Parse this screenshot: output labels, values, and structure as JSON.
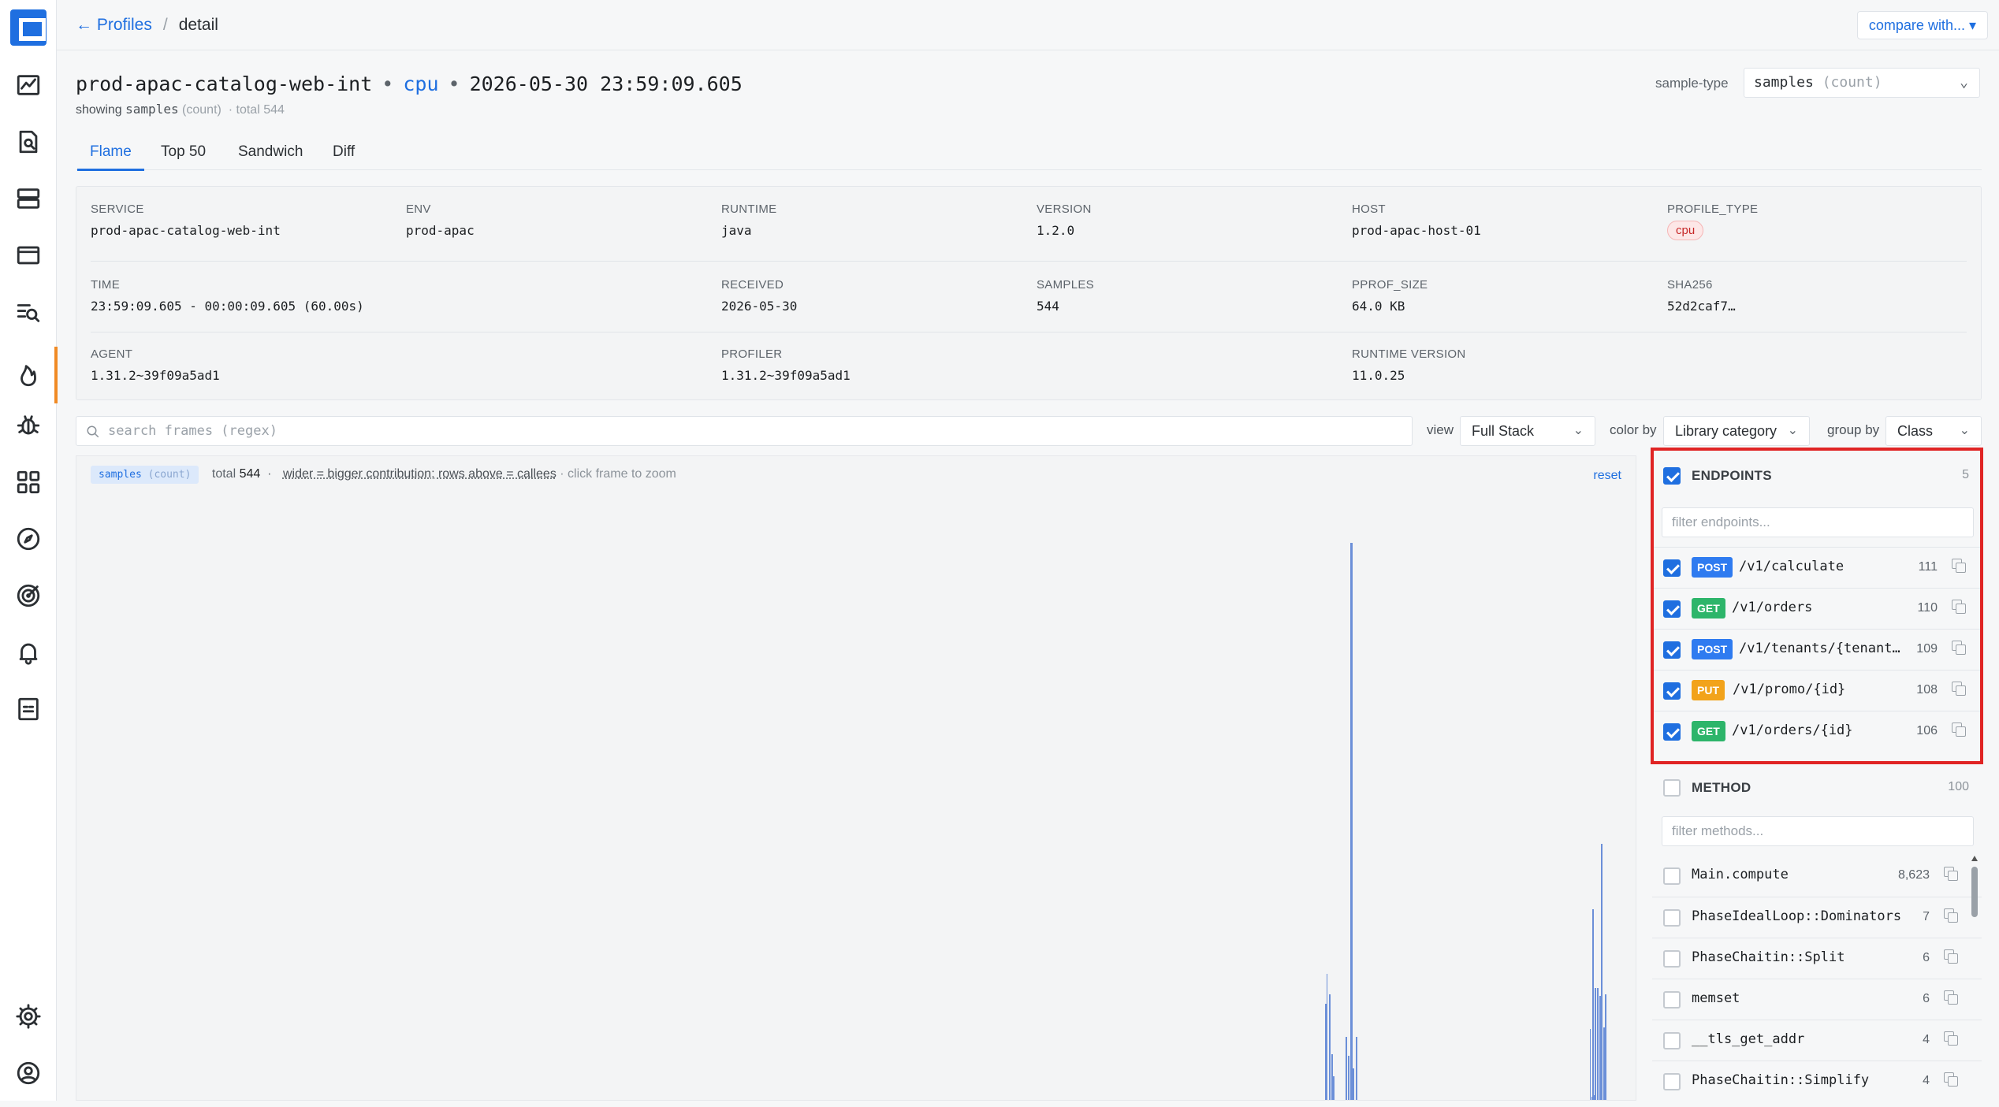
{
  "nav": {
    "items": [
      "dashboard-icon",
      "search-doc-icon",
      "servers-icon",
      "card-icon",
      "search-list-icon",
      "flame-icon",
      "bug-icon",
      "grid-icon",
      "compass-icon",
      "target-icon",
      "bell-icon",
      "report-icon",
      "gear-icon",
      "account-icon"
    ],
    "active": "flame-icon"
  },
  "header": {
    "back_label": "← Profiles",
    "separator": "/",
    "current": "detail",
    "compare_label": "compare with... ▾"
  },
  "profile": {
    "service": "prod-apac-catalog-web-int",
    "dot": "•",
    "type": "cpu",
    "timestamp": "2026-05-30 23:59:09.605",
    "showing_label": "showing",
    "sample_name": "samples",
    "sample_unit": "(count)",
    "total_label": "· total 544"
  },
  "sample_type": {
    "label": "sample-type",
    "value": "samples",
    "unit": "(count)"
  },
  "tabs": [
    "Flame",
    "Top 50",
    "Sandwich",
    "Diff"
  ],
  "active_tab": "Flame",
  "meta": {
    "service_label": "SERVICE",
    "service": "prod-apac-catalog-web-int",
    "env_label": "ENV",
    "env": "prod-apac",
    "runtime_label": "RUNTIME",
    "runtime": "java",
    "version_label": "VERSION",
    "version": "1.2.0",
    "host_label": "HOST",
    "host": "prod-apac-host-01",
    "profile_type_label": "PROFILE_TYPE",
    "profile_type": "cpu",
    "time_label": "TIME",
    "time": "23:59:09.605 - 00:00:09.605 (60.00s)",
    "received_label": "RECEIVED",
    "received": "2026-05-30",
    "samples_label": "SAMPLES",
    "samples": "544",
    "pprof_size_label": "PPROF_SIZE",
    "pprof_size": "64.0 KB",
    "sha_label": "SHA256",
    "sha": "52d2caf7…",
    "agent_label": "AGENT",
    "agent": "1.31.2~39f09a5ad1",
    "profiler_label": "PROFILER",
    "profiler": "1.31.2~39f09a5ad1",
    "runtime_version_label": "RUNTIME VERSION",
    "runtime_version": "11.0.25"
  },
  "controls": {
    "search_placeholder": "search frames (regex)",
    "view_label": "view",
    "view_value": "Full Stack",
    "color_label": "color by",
    "color_value": "Library category",
    "group_label": "group by",
    "group_value": "Class"
  },
  "flame": {
    "chip_name": "samples",
    "chip_unit": "(count)",
    "total_label": "total",
    "total_value": "544",
    "legend": "wider = bigger contribution; rows above = callees",
    "hint": "· click frame to zoom",
    "reset_label": "reset"
  },
  "endpoints": {
    "title": "ENDPOINTS",
    "count": "5",
    "filter_placeholder": "filter endpoints...",
    "items": [
      {
        "method": "POST",
        "path": "/v1/calculate",
        "count": "111"
      },
      {
        "method": "GET",
        "path": "/v1/orders",
        "count": "110"
      },
      {
        "method": "POST",
        "path": "/v1/tenants/{tenant…",
        "count": "109"
      },
      {
        "method": "PUT",
        "path": "/v1/promo/{id}",
        "count": "108"
      },
      {
        "method": "GET",
        "path": "/v1/orders/{id}",
        "count": "106"
      }
    ]
  },
  "methods": {
    "title": "METHOD",
    "count": "100",
    "filter_placeholder": "filter methods...",
    "items": [
      {
        "name": "Main.compute",
        "count": "8,623"
      },
      {
        "name": "PhaseIdealLoop::Dominators",
        "count": "7"
      },
      {
        "name": "PhaseChaitin::Split",
        "count": "6"
      },
      {
        "name": "memset",
        "count": "6"
      },
      {
        "name": "__tls_get_addr",
        "count": "4"
      },
      {
        "name": "PhaseChaitin::Simplify",
        "count": "4"
      }
    ]
  },
  "colors": {
    "accent": "#1f6fe0",
    "highlight_box": "#e02424",
    "active_marker": "#f08a24",
    "post": "#2f7bf0",
    "get": "#2db56a",
    "put": "#f2a31b",
    "flame_bar": "#6b8fd8"
  }
}
